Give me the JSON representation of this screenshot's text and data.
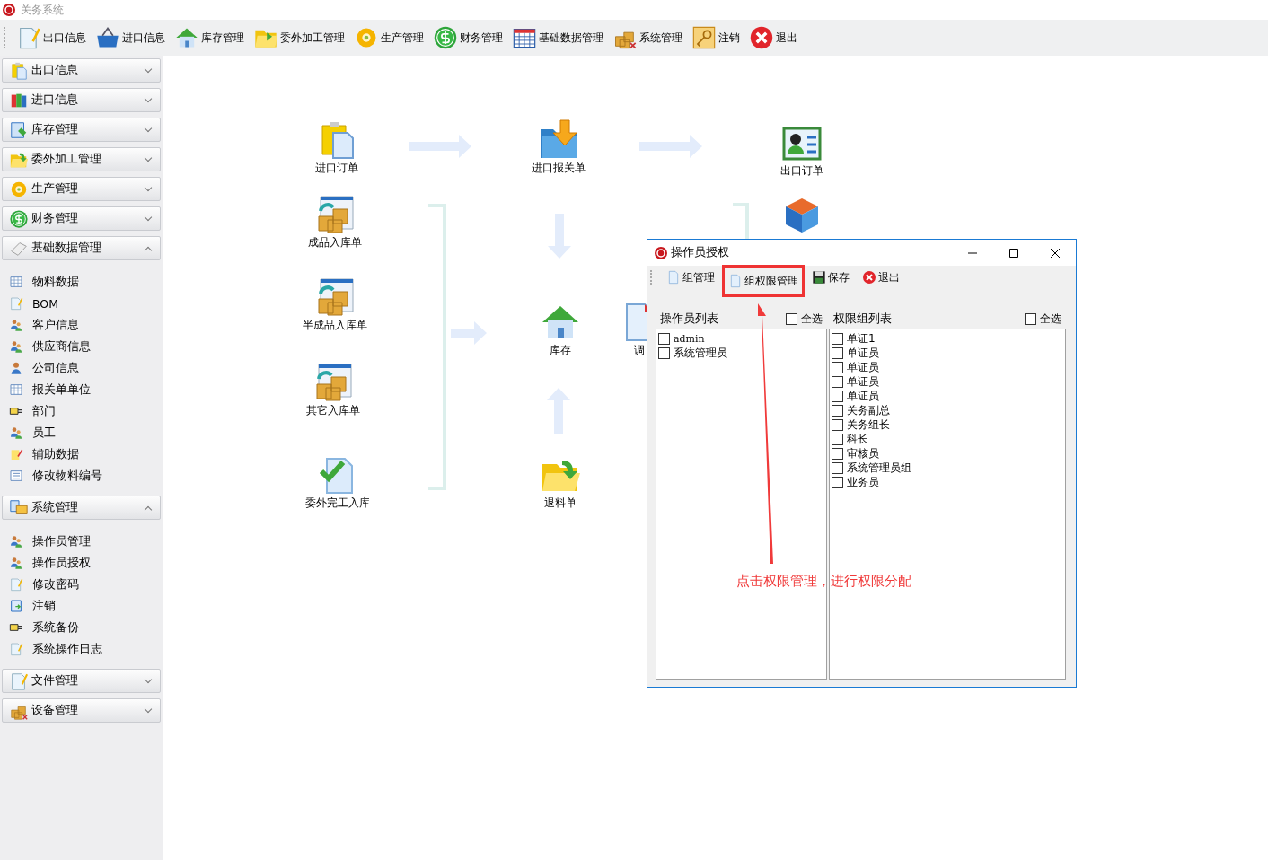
{
  "window": {
    "title": "关务系统"
  },
  "toolbar": [
    "出口信息",
    "进口信息",
    "库存管理",
    "委外加工管理",
    "生产管理",
    "财务管理",
    "基础数据管理",
    "系统管理",
    "注销",
    "退出"
  ],
  "sidebar": {
    "groups": [
      {
        "label": "出口信息",
        "expanded": false
      },
      {
        "label": "进口信息",
        "expanded": false
      },
      {
        "label": "库存管理",
        "expanded": false
      },
      {
        "label": "委外加工管理",
        "expanded": false
      },
      {
        "label": "生产管理",
        "expanded": false
      },
      {
        "label": "财务管理",
        "expanded": false
      },
      {
        "label": "基础数据管理",
        "expanded": true,
        "items": [
          "物料数据",
          "BOM",
          "客户信息",
          "供应商信息",
          "公司信息",
          "报关单单位",
          "部门",
          "员工",
          "辅助数据",
          "修改物料编号"
        ]
      },
      {
        "label": "系统管理",
        "expanded": true,
        "items": [
          "操作员管理",
          "操作员授权",
          "修改密码",
          "注销",
          "系统备份",
          "系统操作日志"
        ]
      },
      {
        "label": "文件管理",
        "expanded": false
      },
      {
        "label": "设备管理",
        "expanded": false
      }
    ]
  },
  "flow": {
    "nodes": [
      "进口订单",
      "进口报关单",
      "出口订单",
      "成品入库单",
      "半成品入库单",
      "库存",
      "调",
      "其它入库单",
      "退料单",
      "委外完工入库"
    ]
  },
  "dialog": {
    "title": "操作员授权",
    "toolbar": [
      {
        "label": "组管理",
        "highlighted": false
      },
      {
        "label": "组权限管理",
        "highlighted": true
      },
      {
        "label": "保存",
        "highlighted": false
      },
      {
        "label": "退出",
        "highlighted": false
      }
    ],
    "operators": {
      "title": "操作员列表",
      "select_all": {
        "label": "全选",
        "checked": false
      },
      "items": [
        {
          "label": "admin",
          "checked": false
        },
        {
          "label": "系统管理员",
          "checked": false
        }
      ]
    },
    "groups": {
      "title": "权限组列表",
      "select_all": {
        "label": "全选",
        "checked": false
      },
      "items": [
        {
          "label": "单证1",
          "checked": false
        },
        {
          "label": "单证员",
          "checked": false
        },
        {
          "label": "单证员",
          "checked": false
        },
        {
          "label": "单证员",
          "checked": false
        },
        {
          "label": "单证员",
          "checked": false
        },
        {
          "label": "关务副总",
          "checked": false
        },
        {
          "label": "关务组长",
          "checked": false
        },
        {
          "label": "科长",
          "checked": false
        },
        {
          "label": "审核员",
          "checked": false
        },
        {
          "label": "系统管理员组",
          "checked": false
        },
        {
          "label": "业务员",
          "checked": false
        }
      ]
    }
  },
  "annotation": {
    "text": "点击权限管理，进行权限分配"
  }
}
